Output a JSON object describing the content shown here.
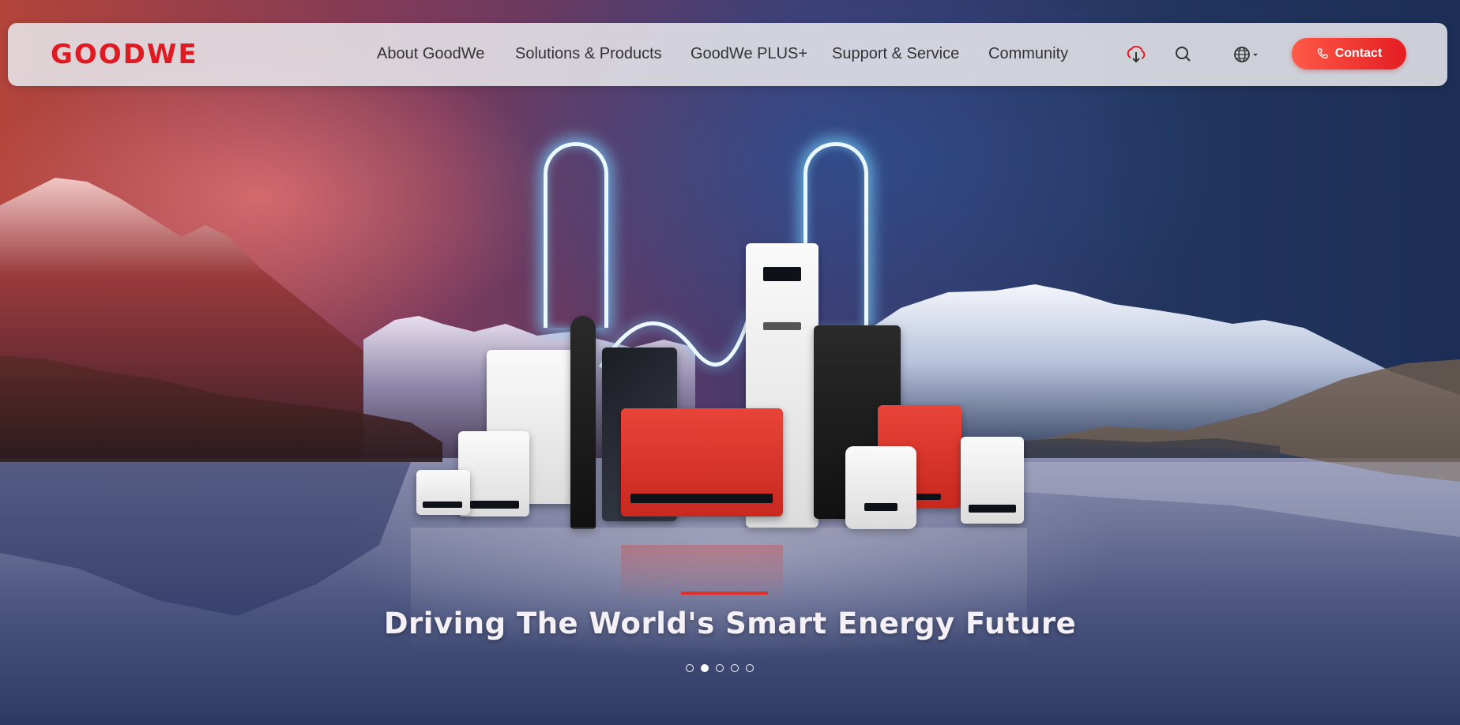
{
  "brand": {
    "logo_text": "GOODWE",
    "logo_color": "#e01a22"
  },
  "nav": {
    "items": [
      {
        "label": "About GoodWe"
      },
      {
        "label": "Solutions & Products"
      },
      {
        "label": "GoodWe PLUS+"
      },
      {
        "label": "Support & Service"
      },
      {
        "label": "Community"
      }
    ]
  },
  "header_icons": {
    "download": "cloud-download-icon",
    "search": "search-icon",
    "language": "globe-icon"
  },
  "contact_button": {
    "label": "Contact",
    "icon": "phone-icon",
    "color": "#e41d23"
  },
  "hero": {
    "headline": "Driving The World's Smart Energy Future",
    "accent_color": "#e0302a",
    "carousel": {
      "total": 5,
      "active_index": 1
    }
  }
}
